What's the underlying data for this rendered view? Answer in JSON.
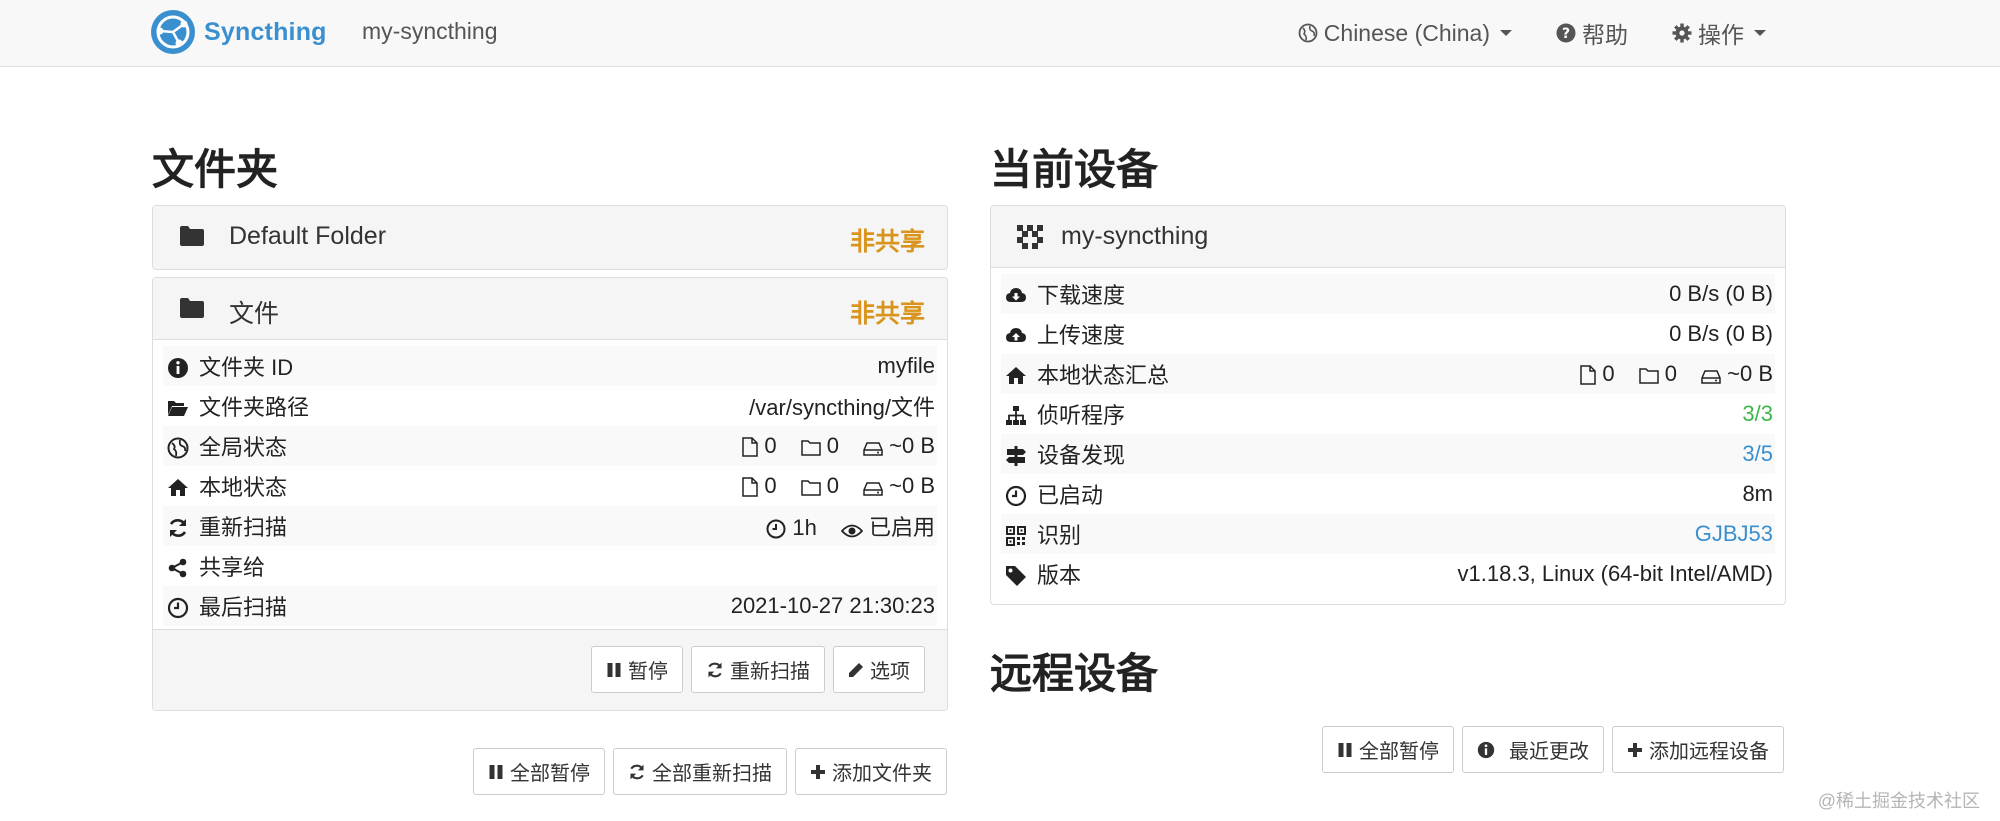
{
  "navbar": {
    "brand": "Syncthing",
    "device_name": "my-syncthing",
    "language": "Chinese (China)",
    "help": "帮助",
    "actions": "操作"
  },
  "folders": {
    "heading": "文件夹",
    "items": [
      {
        "title": "Default Folder",
        "status": "非共享"
      },
      {
        "title": "文件",
        "status": "非共享"
      }
    ],
    "details": {
      "folder_id_label": "文件夹 ID",
      "folder_id_value": "myfile",
      "path_label": "文件夹路径",
      "path_value": "/var/syncthing/文件",
      "global_label": "全局状态",
      "global_files": "0",
      "global_dirs": "0",
      "global_size": "~0 B",
      "local_label": "本地状态",
      "local_files": "0",
      "local_dirs": "0",
      "local_size": "~0 B",
      "rescan_label": "重新扫描",
      "rescan_interval": "1h",
      "watch_label": "已启用",
      "shared_label": "共享给",
      "shared_value": "",
      "last_scan_label": "最后扫描",
      "last_scan_value": "2021-10-27 21:30:23"
    },
    "buttons": {
      "pause": "暂停",
      "rescan": "重新扫描",
      "options": "选项"
    },
    "footer_buttons": {
      "pause_all": "全部暂停",
      "rescan_all": "全部重新扫描",
      "add_folder": "添加文件夹"
    }
  },
  "this_device": {
    "heading": "当前设备",
    "name": "my-syncthing",
    "rows": {
      "download_label": "下载速度",
      "download_value": "0 B/s (0 B)",
      "upload_label": "上传速度",
      "upload_value": "0 B/s (0 B)",
      "local_label": "本地状态汇总",
      "local_files": "0",
      "local_dirs": "0",
      "local_size": "~0 B",
      "listeners_label": "侦听程序",
      "listeners_value": "3/3",
      "discovery_label": "设备发现",
      "discovery_value": "3/5",
      "uptime_label": "已启动",
      "uptime_value": "8m",
      "id_label": "识别",
      "id_value": "GJBJ53",
      "version_label": "版本",
      "version_value": "v1.18.3, Linux (64-bit Intel/AMD)"
    }
  },
  "remote_devices": {
    "heading": "远程设备",
    "buttons": {
      "pause_all": "全部暂停",
      "recent_changes": "最近更改",
      "add_remote": "添加远程设备"
    }
  },
  "watermark": "@稀土掘金技术社区",
  "colors": {
    "brand": "#3a8fcf",
    "warning": "#d9941c",
    "success": "#3fb64a",
    "link": "#3a8fcf"
  }
}
